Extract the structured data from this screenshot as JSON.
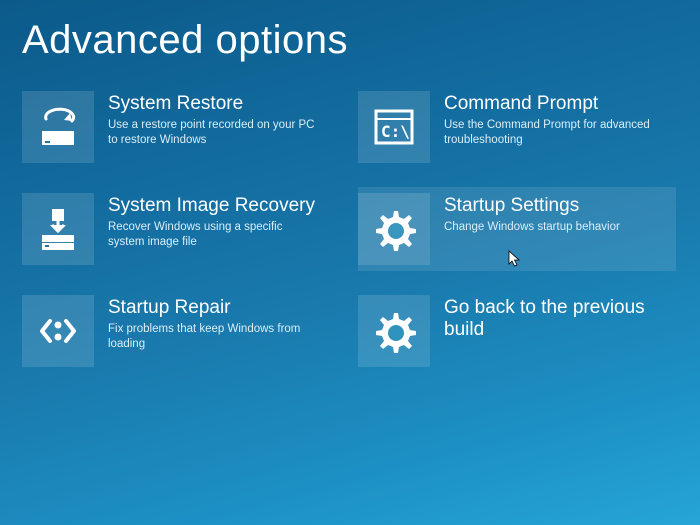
{
  "page": {
    "title": "Advanced options"
  },
  "tiles": [
    {
      "title": "System Restore",
      "desc": "Use a restore point recorded on your PC to restore Windows"
    },
    {
      "title": "Command Prompt",
      "desc": "Use the Command Prompt for advanced troubleshooting"
    },
    {
      "title": "System Image Recovery",
      "desc": "Recover Windows using a specific system image file"
    },
    {
      "title": "Startup Settings",
      "desc": "Change Windows startup behavior"
    },
    {
      "title": "Startup Repair",
      "desc": "Fix problems that keep Windows from loading"
    },
    {
      "title": "Go back to the previous build",
      "desc": ""
    }
  ]
}
